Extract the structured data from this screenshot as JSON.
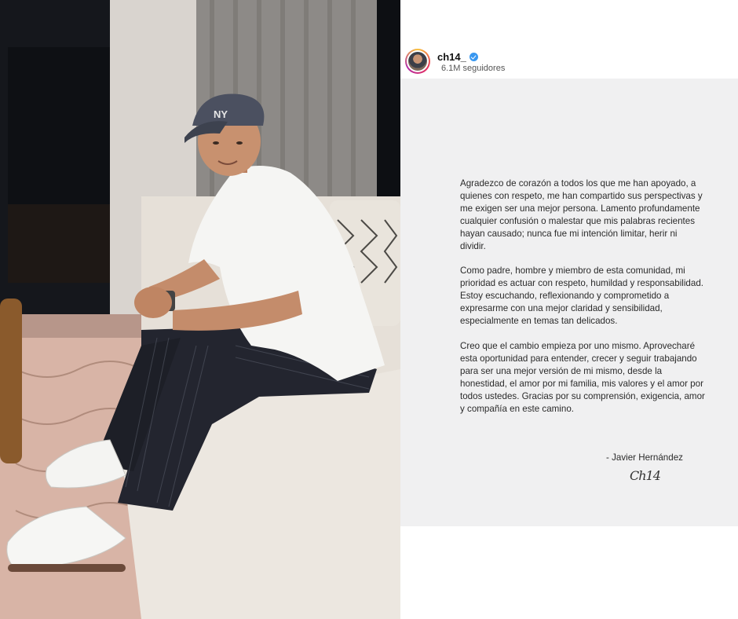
{
  "profile": {
    "username": "ch14_",
    "followers": "6.1M seguidores",
    "verified": true
  },
  "statement": {
    "paragraphs": [
      "Agradezco de corazón a todos los que me han apoyado, a quienes con respeto, me han compartido sus perspectivas y me exigen ser una mejor persona. Lamento profundamente cualquier confusión o malestar que mis palabras recientes hayan causado; nunca fue mi intención limitar, herir ni dividir.",
      "Como padre, hombre y miembro de esta comunidad, mi prioridad es actuar con respeto, humildad y responsabilidad. Estoy escuchando, reflexionando y comprometido a expresarme con una  mejor claridad y sensibilidad, especialmente en temas tan delicados.",
      "Creo que el cambio empieza por uno mismo. Aprovecharé esta oportunidad para entender, crecer y seguir trabajando para ser una mejor versión de mi mismo, desde la honestidad, el amor por mi familia, mis valores y el amor por todos ustedes. Gracias por su comprensión, exigencia, amor y compañía en este camino."
    ],
    "sign_name": "- Javier Hernández",
    "signature": "Ch14"
  },
  "colors": {
    "panel_bg": "#f0f0f1",
    "verified_blue": "#3897f0"
  }
}
